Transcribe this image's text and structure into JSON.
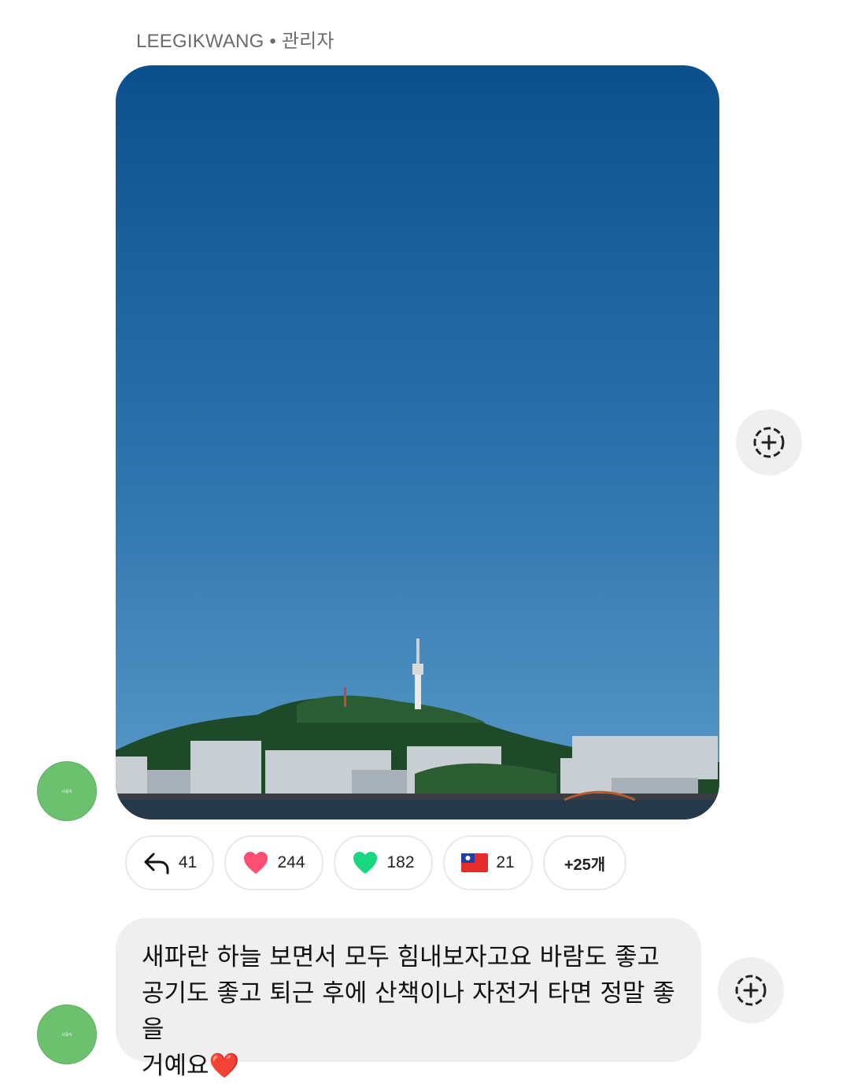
{
  "message_group": {
    "sender_name": "LEEGIKWANG",
    "separator": " • ",
    "sender_role": "관리자",
    "avatar_text": "사용자"
  },
  "reactions": [
    {
      "icon": "reply-arrow-icon",
      "count": "41"
    },
    {
      "icon": "red-heart-icon",
      "emoji": "❤️",
      "count": "244"
    },
    {
      "icon": "green-heart-icon",
      "emoji": "💚",
      "count": "182"
    },
    {
      "icon": "taiwan-flag-icon",
      "emoji": "🇹🇼",
      "count": "21"
    }
  ],
  "reactions_more": "+25개",
  "text_message": {
    "line1": "새파란 하늘 보면서 모두 힘내보자고요 바람도 좋고",
    "line2": "공기도 좋고 퇴근 후에 산책이나 자전거 타면 정말 좋을",
    "line3": "거예요",
    "emoji": "❤️"
  },
  "icons": {
    "add_reaction": "add-reaction-icon"
  },
  "colors": {
    "sky_top": "#0b4f8c",
    "sky_bottom": "#5799c6",
    "avatar": "#6cc16f",
    "bubble": "#efefef"
  }
}
